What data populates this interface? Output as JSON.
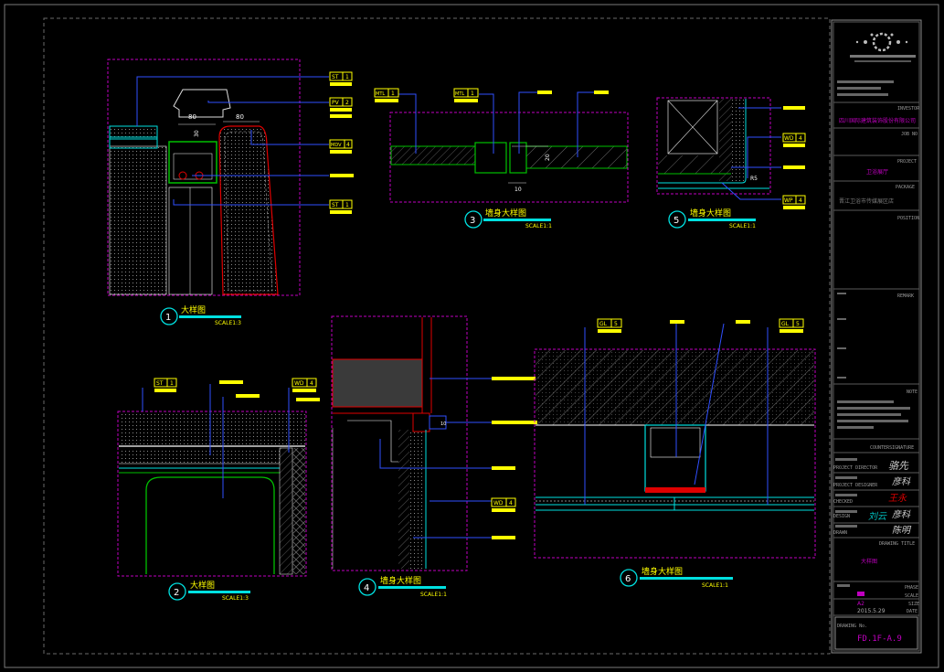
{
  "details": {
    "d1": {
      "num": "1",
      "title": "大样图",
      "scale": "SCALE1:3"
    },
    "d2": {
      "num": "2",
      "title": "大样图",
      "scale": "SCALE1:3"
    },
    "d3": {
      "num": "3",
      "title": "墙身大样图",
      "scale": "SCALE1:1"
    },
    "d4": {
      "num": "4",
      "title": "墙身大样图",
      "scale": "SCALE1:1"
    },
    "d5": {
      "num": "5",
      "title": "墙身大样图",
      "scale": "SCALE1:1"
    },
    "d6": {
      "num": "6",
      "title": "墙身大样图",
      "scale": "SCALE1:1"
    }
  },
  "tags": {
    "st1": {
      "code": "ST",
      "num": "1"
    },
    "pv2": {
      "code": "PV",
      "num": "2"
    },
    "mdv4": {
      "code": "MDV",
      "num": "4"
    },
    "mtl1": {
      "code": "MTL",
      "num": "1"
    },
    "wd4": {
      "code": "WD",
      "num": "4"
    },
    "gl5": {
      "code": "GL",
      "num": "5"
    }
  },
  "dims": {
    "d1_a": "80",
    "d1_b": "80",
    "d1_c": "30",
    "d3_a": "20",
    "d3_b": "10",
    "d5_a": "R5"
  },
  "title_block": {
    "investor": "INVESTOR",
    "job_no": "JOB NO",
    "project": "PROJECT",
    "package": "PACKAGE",
    "package_value": "晋江卫浴市传媒展区店",
    "position": "POSITION",
    "remark": "REMARK",
    "note": "NOTE",
    "countersignature": "COUNTERSIGNATURE",
    "project_director": "PROJECT DIRECTOR",
    "project_designer": "PROJECT DESIGNER",
    "checked": "CHECKED",
    "design": "DESIGN",
    "drawn": "DRAWN",
    "drawing_title": "DRAWING TITLE",
    "drawing_title_value": "大样图",
    "phase": "PHASE",
    "scale": "SCALE",
    "size": "SIZE",
    "size_value": "A2",
    "date": "DATE",
    "date_value": "2015.5.29",
    "drawing_no_label": "DRAWING No.",
    "drawing_no": "FD.1F-A.9"
  },
  "colors": {
    "magenta": "#c000c0",
    "cyan": "#00e0e0",
    "yellow": "#ffff00",
    "green": "#00c000",
    "blue": "#3050ff",
    "red": "#e00000"
  }
}
